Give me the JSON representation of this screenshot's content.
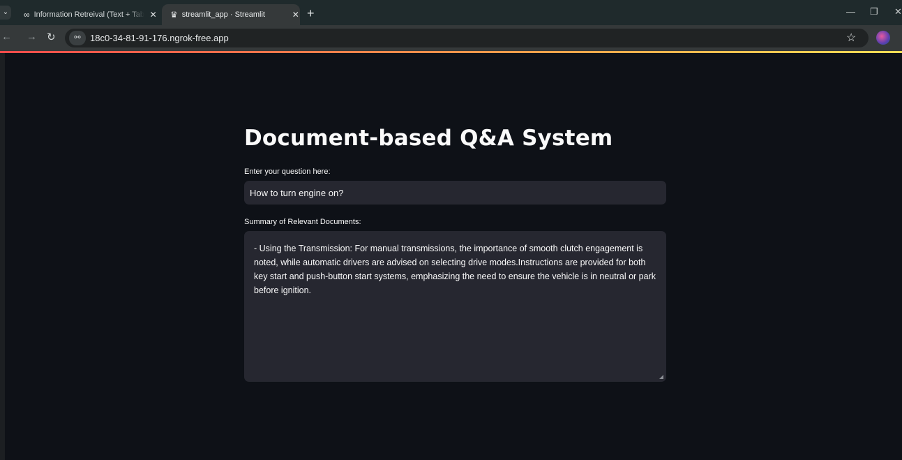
{
  "browser": {
    "tabs": [
      {
        "title": "Information Retreival (Text + Table",
        "favicon": "infinity-icon",
        "active": false
      },
      {
        "title": "streamlit_app · Streamlit",
        "favicon": "streamlit-crown-icon",
        "active": true
      }
    ],
    "url": "18c0-34-81-91-176.ngrok-free.app"
  },
  "app": {
    "title": "Document-based Q&A System",
    "question_label": "Enter your question here:",
    "question_value": "How to turn engine on?",
    "summary_label": "Summary of Relevant Documents:",
    "summary_text": "- Using the Transmission: For manual transmissions, the importance of smooth clutch engagement is noted, while automatic drivers are advised on selecting drive modes.Instructions are provided for both key start and push-button start systems, emphasizing the need to ensure the vehicle is in neutral or park before ignition."
  },
  "colors": {
    "app_background": "#0e1117",
    "input_background": "#262730",
    "text": "#fafafa",
    "tabbar": "#1f2a2c",
    "toolbar": "#35393a"
  }
}
